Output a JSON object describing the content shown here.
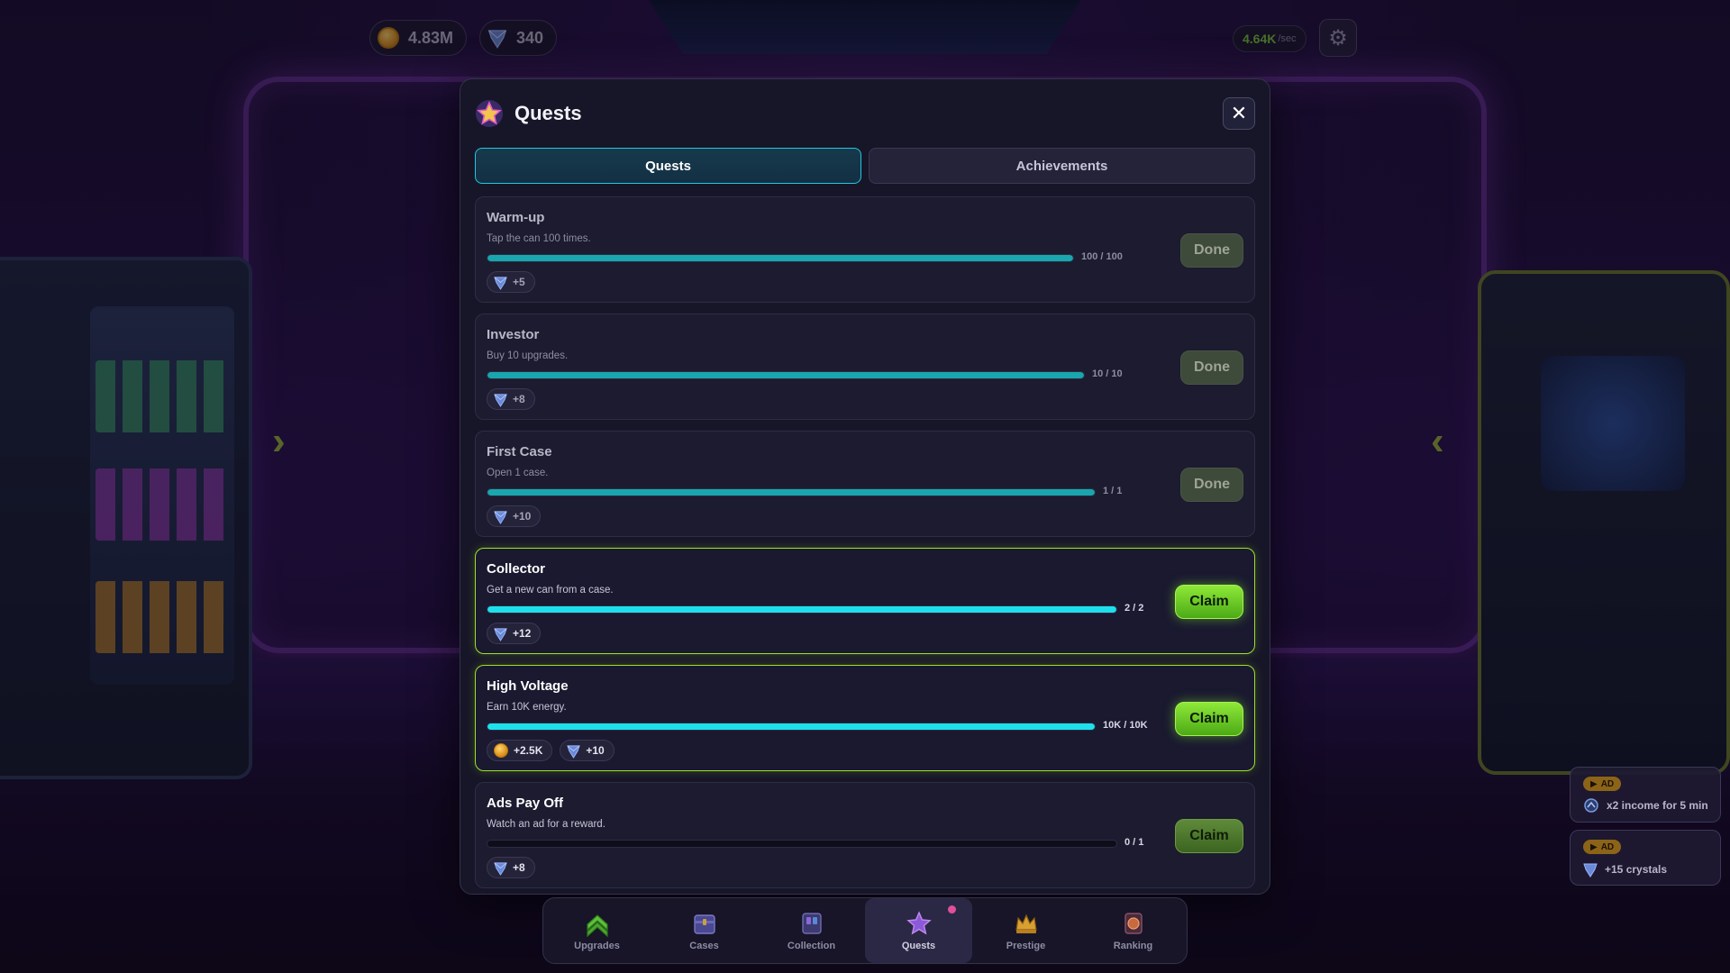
{
  "hud": {
    "coins": "4.83M",
    "crystals": "340",
    "rate_value": "4.64K",
    "rate_unit": "/sec"
  },
  "modal": {
    "title": "Quests",
    "close_icon": "close-icon",
    "tabs": [
      {
        "label": "Quests",
        "active": true
      },
      {
        "label": "Achievements",
        "active": false
      }
    ]
  },
  "quests": [
    {
      "title": "Warm-up",
      "desc": "Tap the can 100 times.",
      "progress": 1.0,
      "count": "100 / 100",
      "rewards": [
        {
          "type": "crystal",
          "label": "+5"
        }
      ],
      "button": "Done",
      "state": "done"
    },
    {
      "title": "Investor",
      "desc": "Buy 10 upgrades.",
      "progress": 1.0,
      "count": "10 / 10",
      "rewards": [
        {
          "type": "crystal",
          "label": "+8"
        }
      ],
      "button": "Done",
      "state": "done"
    },
    {
      "title": "First Case",
      "desc": "Open 1 case.",
      "progress": 1.0,
      "count": "1 / 1",
      "rewards": [
        {
          "type": "crystal",
          "label": "+10"
        }
      ],
      "button": "Done",
      "state": "done"
    },
    {
      "title": "Collector",
      "desc": "Get a new can from a case.",
      "progress": 1.0,
      "count": "2 / 2",
      "rewards": [
        {
          "type": "crystal",
          "label": "+12"
        }
      ],
      "button": "Claim",
      "state": "claimable"
    },
    {
      "title": "High Voltage",
      "desc": "Earn 10K energy.",
      "progress": 1.0,
      "count": "10K / 10K",
      "rewards": [
        {
          "type": "coin",
          "label": "+2.5K"
        },
        {
          "type": "crystal",
          "label": "+10"
        }
      ],
      "button": "Claim",
      "state": "claimable"
    },
    {
      "title": "Ads Pay Off",
      "desc": "Watch an ad for a reward.",
      "progress": 0.0,
      "count": "0 / 1",
      "rewards": [
        {
          "type": "crystal",
          "label": "+8"
        }
      ],
      "button": "Claim",
      "state": "open"
    }
  ],
  "ads": [
    {
      "badge": "AD",
      "text": "x2 income for 5 min",
      "icon": "boost-icon"
    },
    {
      "badge": "AD",
      "text": "+15 crystals",
      "icon": "crystal-icon"
    }
  ],
  "nav": [
    {
      "label": "Upgrades",
      "icon": "upgrades-chevron-icon",
      "active": false
    },
    {
      "label": "Cases",
      "icon": "cases-icon",
      "active": false
    },
    {
      "label": "Collection",
      "icon": "collection-icon",
      "active": false
    },
    {
      "label": "Quests",
      "icon": "quests-star-icon",
      "active": true
    },
    {
      "label": "Prestige",
      "icon": "prestige-crown-icon",
      "active": false
    },
    {
      "label": "Ranking",
      "icon": "ranking-medal-icon",
      "active": false
    }
  ],
  "colors": {
    "accent_cyan": "#1ee0ec",
    "claim_green": "#8ee838",
    "modal_bg": "#171628"
  }
}
